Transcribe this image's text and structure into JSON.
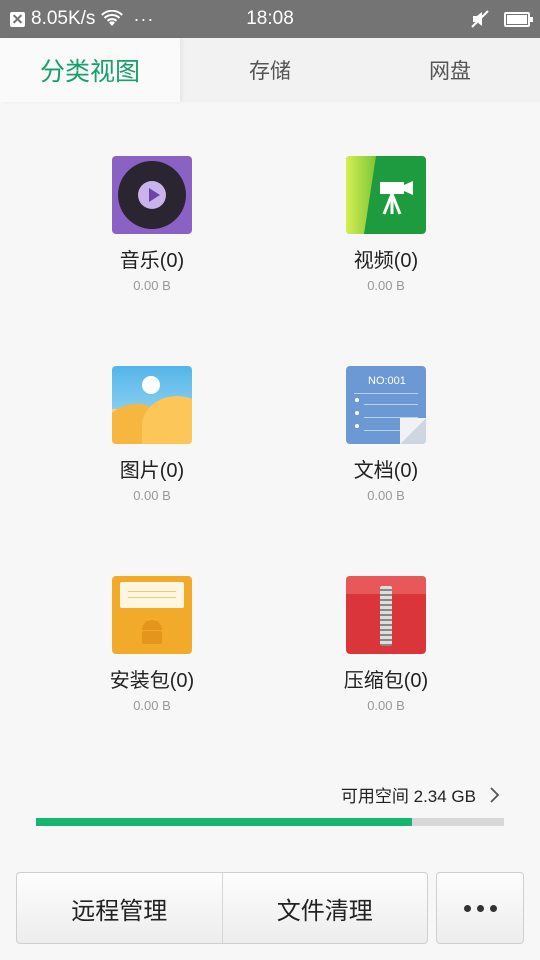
{
  "status_bar": {
    "net_speed": "8.05K/s",
    "more": "···",
    "time": "18:08"
  },
  "tabs": [
    {
      "label": "分类视图",
      "active": true
    },
    {
      "label": "存储",
      "active": false
    },
    {
      "label": "网盘",
      "active": false
    }
  ],
  "categories": [
    {
      "name": "音乐(0)",
      "size": "0.00 B",
      "icon": "music-icon"
    },
    {
      "name": "视频(0)",
      "size": "0.00 B",
      "icon": "video-icon"
    },
    {
      "name": "图片(0)",
      "size": "0.00 B",
      "icon": "photo-icon"
    },
    {
      "name": "文档(0)",
      "size": "0.00 B",
      "icon": "document-icon",
      "icon_text": "NO:001"
    },
    {
      "name": "安装包(0)",
      "size": "0.00 B",
      "icon": "apk-icon"
    },
    {
      "name": "压缩包(0)",
      "size": "0.00 B",
      "icon": "zip-icon"
    }
  ],
  "storage": {
    "available_label": "可用空间 2.34 GB",
    "used_fraction": 0.803
  },
  "bottom_bar": {
    "remote_manage_label": "远程管理",
    "file_clean_label": "文件清理"
  },
  "colors": {
    "accent": "#19a06a",
    "progress": "#15b672",
    "status_bar": "#747474"
  }
}
